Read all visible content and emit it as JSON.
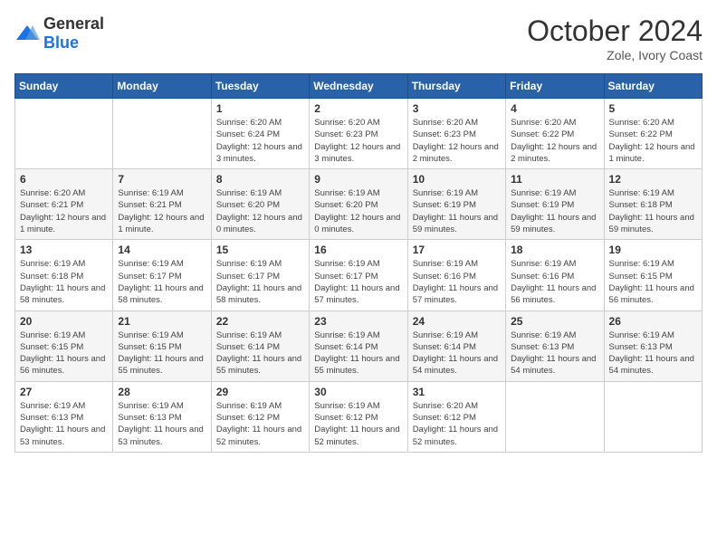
{
  "logo": {
    "general": "General",
    "blue": "Blue"
  },
  "header": {
    "month": "October 2024",
    "location": "Zole, Ivory Coast"
  },
  "weekdays": [
    "Sunday",
    "Monday",
    "Tuesday",
    "Wednesday",
    "Thursday",
    "Friday",
    "Saturday"
  ],
  "weeks": [
    [
      {
        "day": "",
        "content": ""
      },
      {
        "day": "",
        "content": ""
      },
      {
        "day": "1",
        "content": "Sunrise: 6:20 AM\nSunset: 6:24 PM\nDaylight: 12 hours and 3 minutes."
      },
      {
        "day": "2",
        "content": "Sunrise: 6:20 AM\nSunset: 6:23 PM\nDaylight: 12 hours and 3 minutes."
      },
      {
        "day": "3",
        "content": "Sunrise: 6:20 AM\nSunset: 6:23 PM\nDaylight: 12 hours and 2 minutes."
      },
      {
        "day": "4",
        "content": "Sunrise: 6:20 AM\nSunset: 6:22 PM\nDaylight: 12 hours and 2 minutes."
      },
      {
        "day": "5",
        "content": "Sunrise: 6:20 AM\nSunset: 6:22 PM\nDaylight: 12 hours and 1 minute."
      }
    ],
    [
      {
        "day": "6",
        "content": "Sunrise: 6:20 AM\nSunset: 6:21 PM\nDaylight: 12 hours and 1 minute."
      },
      {
        "day": "7",
        "content": "Sunrise: 6:19 AM\nSunset: 6:21 PM\nDaylight: 12 hours and 1 minute."
      },
      {
        "day": "8",
        "content": "Sunrise: 6:19 AM\nSunset: 6:20 PM\nDaylight: 12 hours and 0 minutes."
      },
      {
        "day": "9",
        "content": "Sunrise: 6:19 AM\nSunset: 6:20 PM\nDaylight: 12 hours and 0 minutes."
      },
      {
        "day": "10",
        "content": "Sunrise: 6:19 AM\nSunset: 6:19 PM\nDaylight: 11 hours and 59 minutes."
      },
      {
        "day": "11",
        "content": "Sunrise: 6:19 AM\nSunset: 6:19 PM\nDaylight: 11 hours and 59 minutes."
      },
      {
        "day": "12",
        "content": "Sunrise: 6:19 AM\nSunset: 6:18 PM\nDaylight: 11 hours and 59 minutes."
      }
    ],
    [
      {
        "day": "13",
        "content": "Sunrise: 6:19 AM\nSunset: 6:18 PM\nDaylight: 11 hours and 58 minutes."
      },
      {
        "day": "14",
        "content": "Sunrise: 6:19 AM\nSunset: 6:17 PM\nDaylight: 11 hours and 58 minutes."
      },
      {
        "day": "15",
        "content": "Sunrise: 6:19 AM\nSunset: 6:17 PM\nDaylight: 11 hours and 58 minutes."
      },
      {
        "day": "16",
        "content": "Sunrise: 6:19 AM\nSunset: 6:17 PM\nDaylight: 11 hours and 57 minutes."
      },
      {
        "day": "17",
        "content": "Sunrise: 6:19 AM\nSunset: 6:16 PM\nDaylight: 11 hours and 57 minutes."
      },
      {
        "day": "18",
        "content": "Sunrise: 6:19 AM\nSunset: 6:16 PM\nDaylight: 11 hours and 56 minutes."
      },
      {
        "day": "19",
        "content": "Sunrise: 6:19 AM\nSunset: 6:15 PM\nDaylight: 11 hours and 56 minutes."
      }
    ],
    [
      {
        "day": "20",
        "content": "Sunrise: 6:19 AM\nSunset: 6:15 PM\nDaylight: 11 hours and 56 minutes."
      },
      {
        "day": "21",
        "content": "Sunrise: 6:19 AM\nSunset: 6:15 PM\nDaylight: 11 hours and 55 minutes."
      },
      {
        "day": "22",
        "content": "Sunrise: 6:19 AM\nSunset: 6:14 PM\nDaylight: 11 hours and 55 minutes."
      },
      {
        "day": "23",
        "content": "Sunrise: 6:19 AM\nSunset: 6:14 PM\nDaylight: 11 hours and 55 minutes."
      },
      {
        "day": "24",
        "content": "Sunrise: 6:19 AM\nSunset: 6:14 PM\nDaylight: 11 hours and 54 minutes."
      },
      {
        "day": "25",
        "content": "Sunrise: 6:19 AM\nSunset: 6:13 PM\nDaylight: 11 hours and 54 minutes."
      },
      {
        "day": "26",
        "content": "Sunrise: 6:19 AM\nSunset: 6:13 PM\nDaylight: 11 hours and 54 minutes."
      }
    ],
    [
      {
        "day": "27",
        "content": "Sunrise: 6:19 AM\nSunset: 6:13 PM\nDaylight: 11 hours and 53 minutes."
      },
      {
        "day": "28",
        "content": "Sunrise: 6:19 AM\nSunset: 6:13 PM\nDaylight: 11 hours and 53 minutes."
      },
      {
        "day": "29",
        "content": "Sunrise: 6:19 AM\nSunset: 6:12 PM\nDaylight: 11 hours and 52 minutes."
      },
      {
        "day": "30",
        "content": "Sunrise: 6:19 AM\nSunset: 6:12 PM\nDaylight: 11 hours and 52 minutes."
      },
      {
        "day": "31",
        "content": "Sunrise: 6:20 AM\nSunset: 6:12 PM\nDaylight: 11 hours and 52 minutes."
      },
      {
        "day": "",
        "content": ""
      },
      {
        "day": "",
        "content": ""
      }
    ]
  ]
}
